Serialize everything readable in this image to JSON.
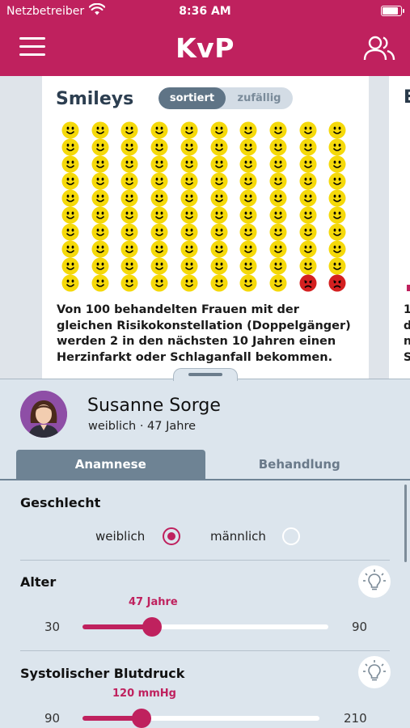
{
  "status_bar": {
    "carrier": "Netzbetreiber",
    "time": "8:36 AM",
    "icons": [
      "wifi-icon",
      "battery-icon"
    ]
  },
  "nav": {
    "title": "KvP",
    "menu_icon": "hamburger-icon",
    "users_icon": "users-icon"
  },
  "card": {
    "title": "Smileys",
    "toggle": {
      "options": [
        "sortiert",
        "zufällig"
      ],
      "selected": "sortiert"
    },
    "smileys": {
      "total": 100,
      "columns": 10,
      "sad_count": 2,
      "happy_color": "#f5d90a",
      "sad_color": "#d42020"
    },
    "text": "Von 100 behandelten Frauen mit der gleichen Risikokonstellation (Doppelgänger) werden 2 in den nächsten 10 Jahren einen Herzinfarkt oder Schlaganfall bekommen."
  },
  "next_card_peek": {
    "title": "E",
    "text_lines": [
      "1",
      "d",
      "n",
      "S"
    ]
  },
  "patient": {
    "name": "Susanne Sorge",
    "info": "weiblich · 47 Jahre",
    "avatar_icon": "avatar-woman-icon"
  },
  "tabs": [
    {
      "label": "Anamnese",
      "active": true
    },
    {
      "label": "Behandlung",
      "active": false
    }
  ],
  "form": {
    "gender": {
      "label": "Geschlecht",
      "options": [
        "weiblich",
        "männlich"
      ],
      "selected": "weiblich"
    },
    "age": {
      "label": "Alter",
      "value_label": "47 Jahre",
      "value": 47,
      "min": 30,
      "max": 90,
      "hint_icon": "lightbulb-icon"
    },
    "bp": {
      "label": "Systolischer Blutdruck",
      "value_label": "120 mmHg",
      "value": 120,
      "min": 90,
      "max": 210,
      "hint_icon": "lightbulb-icon"
    }
  },
  "colors": {
    "brand": "#bf215e",
    "tab_active": "#6e8394",
    "sheet_bg": "#dce5ed"
  }
}
